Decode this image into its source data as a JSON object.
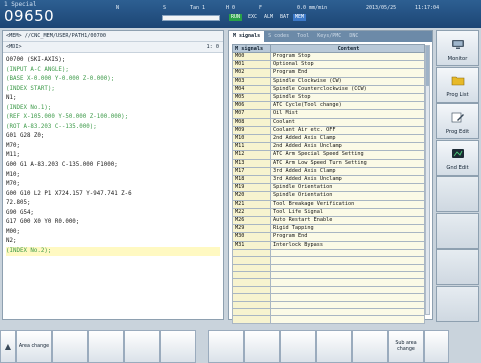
{
  "status_bar": {
    "mode": "1 Special",
    "program_number": "09650",
    "n_label": "N",
    "s_label": "S",
    "t_label": "T",
    "f_label": "F",
    "t_value": "Tan 1",
    "h_value": "H 0",
    "feed": "0.0 mm/min",
    "date": "2013/05/25",
    "time": "11:17:04",
    "tags": [
      "RUN",
      "EXC",
      "ALM",
      "BAT",
      "MEM"
    ]
  },
  "program_panel": {
    "path": "<MEM> //CNC_MEM/USER/PATH1/00700",
    "sub_label": "<MDI>",
    "counter": "1: 0",
    "lines": [
      {
        "text": "O0700 (SKI-AXIS);",
        "comment": false,
        "selected": false
      },
      {
        "text": "(INPUT A-C ANGLE);",
        "comment": true,
        "selected": false
      },
      {
        "text": "(BASE X-0.000 Y-0.000 Z-0.000);",
        "comment": true,
        "selected": false
      },
      {
        "text": "(INDEX START);",
        "comment": true,
        "selected": false
      },
      {
        "text": "N1;",
        "comment": false,
        "selected": false
      },
      {
        "text": "(INDEX No.1);",
        "comment": true,
        "selected": false
      },
      {
        "text": "(REF X-105.000 Y-50.000 Z-100.000);",
        "comment": true,
        "selected": false
      },
      {
        "text": "(ROT A-83.203 C--135.000);",
        "comment": true,
        "selected": false
      },
      {
        "text": "G01 G28 Z0;",
        "comment": false,
        "selected": false
      },
      {
        "text": "M70;",
        "comment": false,
        "selected": false
      },
      {
        "text": "M11;",
        "comment": false,
        "selected": false
      },
      {
        "text": "G00 G1 A-83.203 C-135.000 F1000;",
        "comment": false,
        "selected": false
      },
      {
        "text": "M10;",
        "comment": false,
        "selected": false
      },
      {
        "text": "M70;",
        "comment": false,
        "selected": false
      },
      {
        "text": "G00 G10 L2 P1 X724.157 Y-947.741 Z-6",
        "comment": false,
        "selected": false
      },
      {
        "text": "72.805;",
        "comment": false,
        "selected": false
      },
      {
        "text": "G90 G54;",
        "comment": false,
        "selected": false
      },
      {
        "text": "G17 G00 X0 Y0 R0.000;",
        "comment": false,
        "selected": false
      },
      {
        "text": "M00;",
        "comment": false,
        "selected": false
      },
      {
        "text": "N2;",
        "comment": false,
        "selected": false
      },
      {
        "text": "(INDEX No.2);",
        "comment": true,
        "selected": true
      }
    ]
  },
  "signals_panel": {
    "tabs": [
      "M signals",
      "S codes",
      "Tool",
      "Keys/PMC",
      "DNC"
    ],
    "headers": {
      "code": "M signals",
      "desc": "Content"
    },
    "rows": [
      {
        "code": "M00",
        "desc": "Program Stop"
      },
      {
        "code": "M01",
        "desc": "Optional Stop"
      },
      {
        "code": "M02",
        "desc": "Program End"
      },
      {
        "code": "M03",
        "desc": "Spindle Clockwise (CW)"
      },
      {
        "code": "M04",
        "desc": "Spindle Counterclockwise (CCW)"
      },
      {
        "code": "M05",
        "desc": "Spindle Stop"
      },
      {
        "code": "M06",
        "desc": "ATC Cycle(Tool change)"
      },
      {
        "code": "M07",
        "desc": "Oil Mist"
      },
      {
        "code": "M08",
        "desc": "Coolant"
      },
      {
        "code": "M09",
        "desc": "Coolant Air etc. OFF"
      },
      {
        "code": "M10",
        "desc": "2nd Added Axis Clamp"
      },
      {
        "code": "M11",
        "desc": "2nd Added Axis Unclamp"
      },
      {
        "code": "M12",
        "desc": "ATC Arm Special Speed Setting"
      },
      {
        "code": "M13",
        "desc": "ATC Arm Low Speed Turn Setting"
      },
      {
        "code": "M17",
        "desc": "3rd Added Axis Clamp"
      },
      {
        "code": "M18",
        "desc": "3rd Added Axis Unclamp"
      },
      {
        "code": "M19",
        "desc": "Spindle Orientation"
      },
      {
        "code": "M20",
        "desc": "Spindle Orientation"
      },
      {
        "code": "M21",
        "desc": "Tool Breakage Verification"
      },
      {
        "code": "M22",
        "desc": "Tool Life Signal"
      },
      {
        "code": "M26",
        "desc": "Auto Restart Enable"
      },
      {
        "code": "M29",
        "desc": "Rigid Tapping"
      },
      {
        "code": "M30",
        "desc": "Program End"
      },
      {
        "code": "M31",
        "desc": "Interlock Bypass"
      },
      {
        "code": "",
        "desc": ""
      },
      {
        "code": "",
        "desc": ""
      },
      {
        "code": "",
        "desc": ""
      },
      {
        "code": "",
        "desc": ""
      },
      {
        "code": "",
        "desc": ""
      },
      {
        "code": "",
        "desc": ""
      },
      {
        "code": "",
        "desc": ""
      },
      {
        "code": "",
        "desc": ""
      },
      {
        "code": "",
        "desc": ""
      },
      {
        "code": "",
        "desc": ""
      }
    ]
  },
  "side_buttons": [
    {
      "label": "Monitor",
      "icon": "monitor-icon"
    },
    {
      "label": "Prog List",
      "icon": "folder-icon"
    },
    {
      "label": "Prog Edit",
      "icon": "edit-pen-icon"
    },
    {
      "label": "Gnd Edit",
      "icon": "graphic-edit-icon"
    },
    {
      "label": "",
      "icon": ""
    },
    {
      "label": "",
      "icon": ""
    },
    {
      "label": "",
      "icon": ""
    },
    {
      "label": "",
      "icon": ""
    }
  ],
  "softkeys": {
    "left": "Area change",
    "right": "Sub area change"
  },
  "colors": {
    "topbar": "#1c4574",
    "comment_text": "#3c9a48",
    "selected_line": "#fff9c2",
    "table_code_bg": "#f7f3cf"
  }
}
